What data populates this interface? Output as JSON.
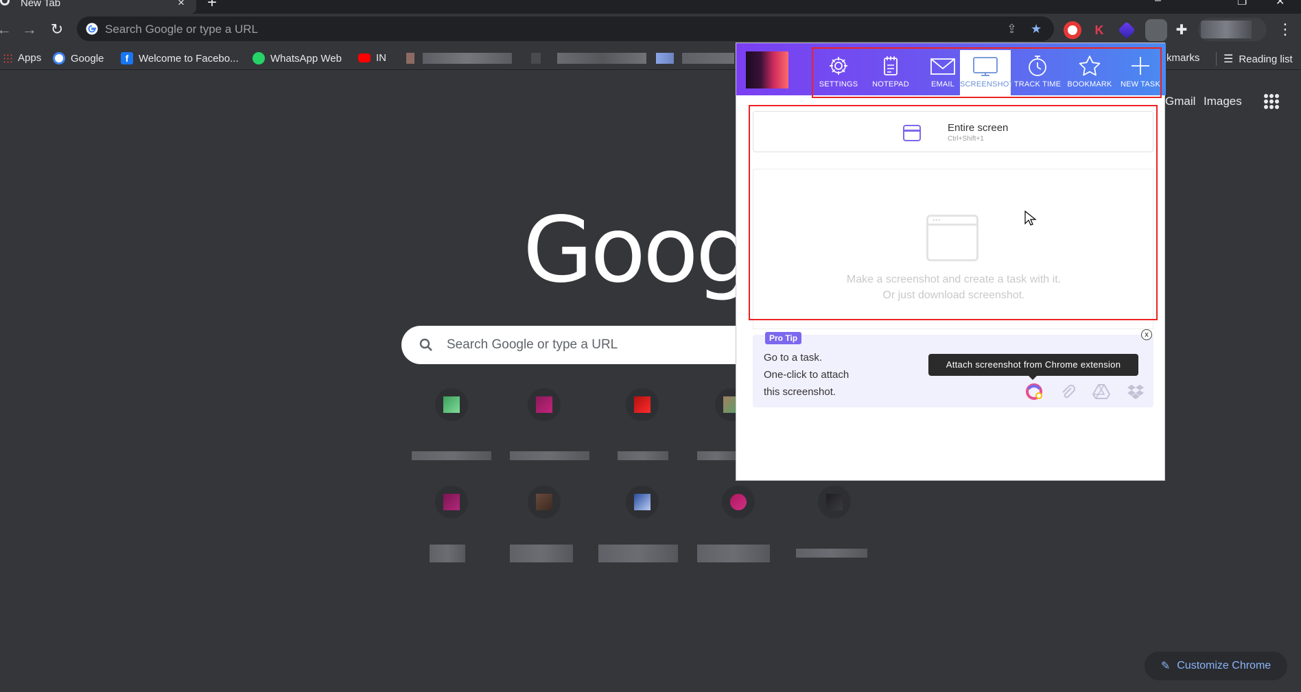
{
  "browser": {
    "tab_title": "New Tab",
    "tab_close": "×",
    "new_tab": "+",
    "omnibox_placeholder": "Search Google or type a URL"
  },
  "bookmarks": {
    "apps": "Apps",
    "google": "Google",
    "facebook": "Welcome to Facebo...",
    "whatsapp": "WhatsApp Web",
    "youtube": "IN",
    "all_bookmarks": "kmarks",
    "reading_list": "Reading list"
  },
  "ntp": {
    "gmail": "Gmail",
    "images": "Images",
    "logo_text": "Google",
    "search_placeholder": "Search Google or type a URL",
    "customize_label": "Customize Chrome"
  },
  "popup": {
    "nav": [
      {
        "label": "SETTINGS",
        "icon": "gear-icon"
      },
      {
        "label": "NOTEPAD",
        "icon": "notepad-icon"
      },
      {
        "label": "EMAIL",
        "icon": "email-icon"
      },
      {
        "label": "SCREENSHOT",
        "icon": "monitor-icon"
      },
      {
        "label": "TRACK TIME",
        "icon": "stopwatch-icon"
      },
      {
        "label": "BOOKMARK",
        "icon": "star-icon"
      },
      {
        "label": "NEW TASK",
        "icon": "plus-icon"
      }
    ],
    "entire_screen_title": "Entire screen",
    "entire_screen_shortcut": "Ctrl+Shift+1",
    "drop_line1": "Make a screenshot and create a task with it.",
    "drop_line2": "Or just download screenshot.",
    "protip_badge": "Pro Tip",
    "protip_close": "x",
    "protip_line1": "Go to a task.",
    "protip_line2": "One-click to attach",
    "protip_line3": "this screenshot.",
    "tooltip": "Attach screenshot from Chrome extension"
  },
  "colors": {
    "accent_purple": "#7b68ee",
    "header_gradient_start": "#7b3ff2",
    "header_gradient_end": "#4a8af0",
    "highlight_red": "#e22222",
    "ntp_background": "#35363a"
  }
}
